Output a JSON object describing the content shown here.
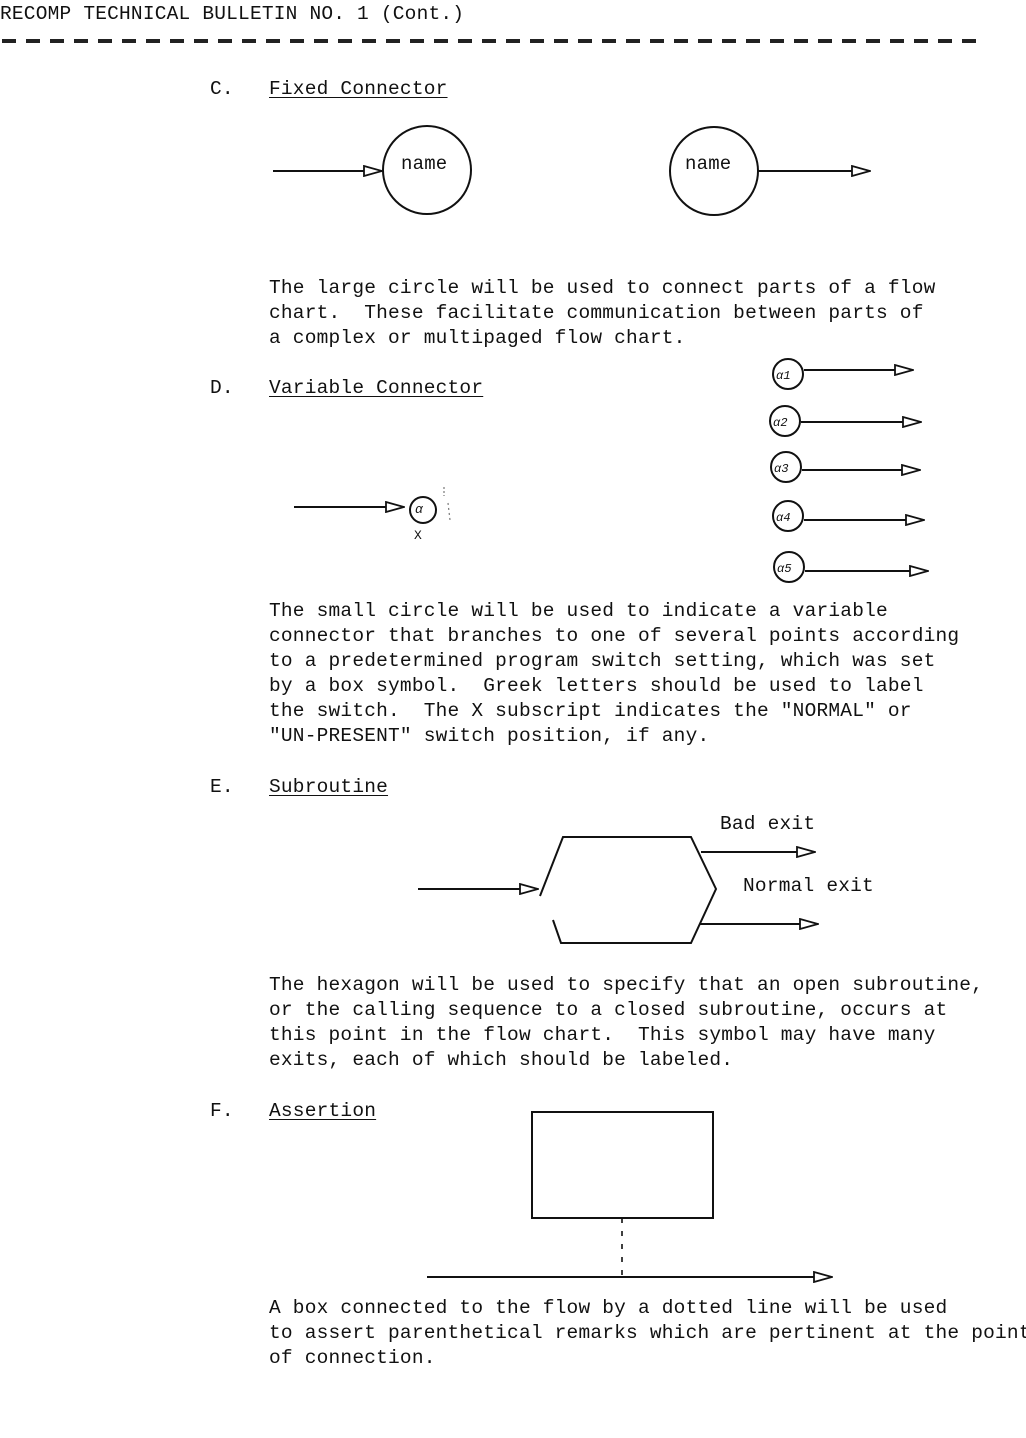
{
  "header": {
    "title": "RECOMP TECHNICAL BULLETIN NO. 1 (Cont.)"
  },
  "sections": [
    {
      "letter": "C.",
      "heading": "Fixed Connector",
      "diagram": {
        "left_label": "name",
        "right_label": "name"
      },
      "body": [
        "The large circle will be used to connect parts of a flow",
        "chart.  These facilitate communication between parts of",
        "a complex or multipaged flow chart."
      ]
    },
    {
      "letter": "D.",
      "heading": "Variable Connector",
      "diagram": {
        "main_label": "α",
        "subscript": "X",
        "branches": [
          "α1",
          "α2",
          "α3",
          "α4",
          "α5"
        ]
      },
      "body": [
        "The small circle will be used to indicate a variable",
        "connector that branches to one of several points according",
        "to a predetermined program switch setting, which was set",
        "by a box symbol.  Greek letters should be used to label",
        "the switch.  The X subscript indicates the \"NORMAL\" or",
        "\"UN-PRESENT\" switch position, if any."
      ]
    },
    {
      "letter": "E.",
      "heading": "Subroutine",
      "diagram": {
        "exit_labels": [
          "Bad exit",
          "Normal exit"
        ]
      },
      "body": [
        "The hexagon will be used to specify that an open subroutine,",
        "or the calling sequence to a closed subroutine, occurs at",
        "this point in the flow chart.  This symbol may have many",
        "exits, each of which should be labeled."
      ]
    },
    {
      "letter": "F.",
      "heading": "Assertion",
      "body": [
        "A box connected to the flow by a dotted line will be used",
        "to assert parenthetical remarks which are pertinent at the point",
        "of connection."
      ]
    }
  ]
}
